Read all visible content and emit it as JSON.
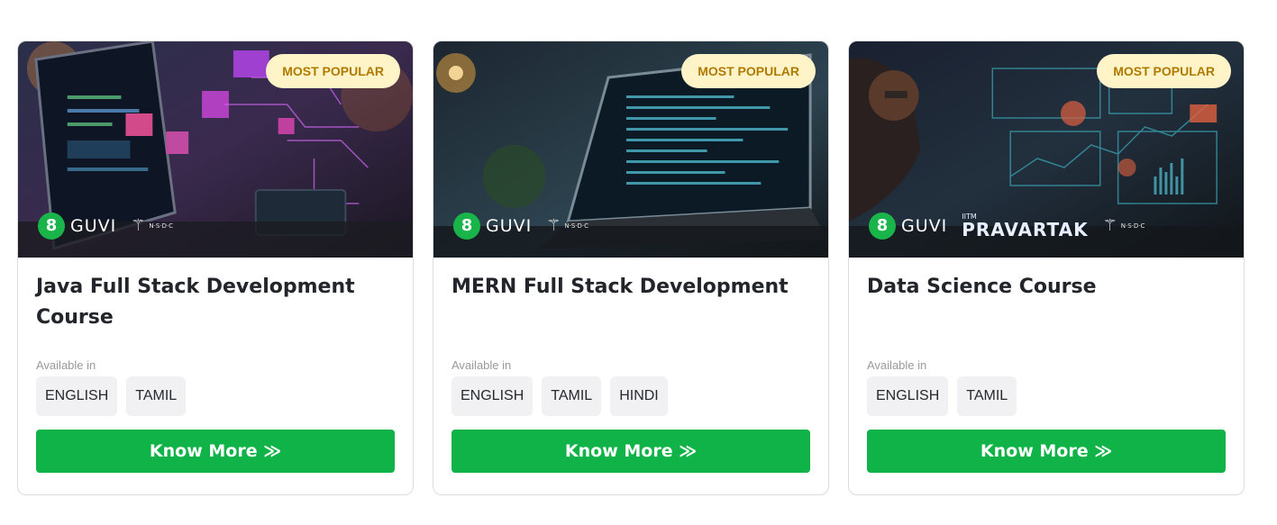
{
  "cards": [
    {
      "badge": "MOST POPULAR",
      "title": "Java Full Stack Development Course",
      "available_label": "Available in",
      "languages": [
        "ENGLISH",
        "TAMIL"
      ],
      "cta_label": "Know More ≫",
      "logos": {
        "guvi": "GUVI",
        "nsdc": "N·S·D·C"
      }
    },
    {
      "badge": "MOST POPULAR",
      "title": "MERN Full Stack Development",
      "available_label": "Available in",
      "languages": [
        "ENGLISH",
        "TAMIL",
        "HINDI"
      ],
      "cta_label": "Know More ≫",
      "logos": {
        "guvi": "GUVI",
        "nsdc": "N·S·D·C"
      }
    },
    {
      "badge": "MOST POPULAR",
      "title": "Data Science Course",
      "available_label": "Available in",
      "languages": [
        "ENGLISH",
        "TAMIL"
      ],
      "cta_label": "Know More ≫",
      "logos": {
        "guvi": "GUVI",
        "iitm": "IITM",
        "pravartak": "PRAVARTAK",
        "nsdc": "N·S·D·C"
      }
    }
  ],
  "colors": {
    "badge_bg": "#fff4c7",
    "badge_text": "#b07a00",
    "cta_bg": "#10b347",
    "guvi_green": "#19b44a"
  }
}
